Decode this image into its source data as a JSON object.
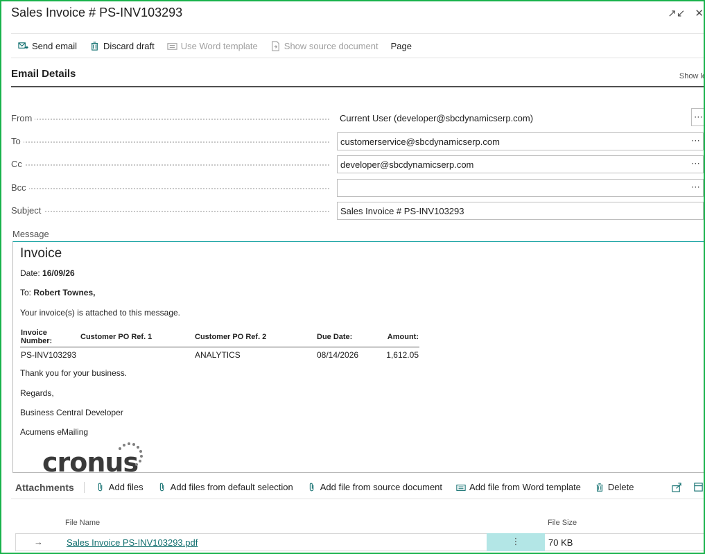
{
  "window": {
    "title": "Sales Invoice # PS-INV103293"
  },
  "actions": {
    "send_email": "Send email",
    "discard_draft": "Discard draft",
    "use_word_template": "Use Word template",
    "show_source_document": "Show source document",
    "page": "Page"
  },
  "section": {
    "title": "Email Details",
    "show_less": "Show le"
  },
  "fields": {
    "from": {
      "label": "From",
      "value": "Current User (developer@sbcdynamicserp.com)"
    },
    "to": {
      "label": "To",
      "value": "customerservice@sbcdynamicserp.com"
    },
    "cc": {
      "label": "Cc",
      "value": "developer@sbcdynamicserp.com"
    },
    "bcc": {
      "label": "Bcc",
      "value": ""
    },
    "subject": {
      "label": "Subject",
      "value": "Sales Invoice # PS-INV103293"
    }
  },
  "message": {
    "label": "Message",
    "heading": "Invoice",
    "date_label": "Date: ",
    "date_value": "16/09/26",
    "to_label": "To: ",
    "to_value": "Robert Townes,",
    "intro": "Your invoice(s) is attached to this message.",
    "table_headers": [
      "Invoice Number:",
      "Customer PO Ref. 1",
      "Customer PO Ref. 2",
      "Due Date:",
      "Amount:"
    ],
    "table_row": [
      "PS-INV103293",
      "",
      "ANALYTICS",
      "08/14/2026",
      "1,612.05"
    ],
    "thanks": "Thank you for your business.",
    "regards": "Regards,",
    "signature1": "Business Central Developer",
    "signature2": "Acumens eMailing",
    "logo_text": "cronus"
  },
  "attachments": {
    "title": "Attachments",
    "add_files": "Add files",
    "add_default": "Add files from default selection",
    "add_source": "Add file from source document",
    "add_word": "Add file from Word template",
    "delete": "Delete",
    "col_file_name": "File Name",
    "col_file_size": "File Size",
    "rows": [
      {
        "file_name": "Sales Invoice PS-INV103293.pdf",
        "file_size": "70 KB"
      }
    ]
  },
  "colors": {
    "accent": "#0f6e6e",
    "frame": "#19b24b",
    "selected_cell": "#b3e6e6"
  }
}
